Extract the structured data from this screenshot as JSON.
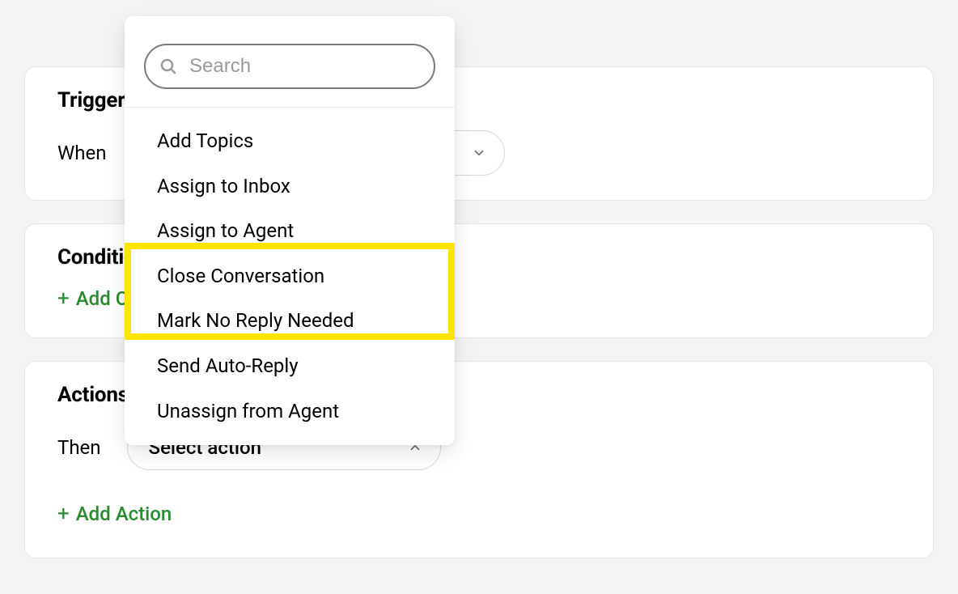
{
  "trigger": {
    "title": "Trigger",
    "when_label": "When"
  },
  "conditions": {
    "title": "Conditions",
    "add_label": "Add Condition"
  },
  "actions": {
    "title": "Actions",
    "then_label": "Then",
    "select_placeholder": "Select action",
    "add_label": "Add Action"
  },
  "popover": {
    "search_placeholder": "Search",
    "options": [
      "Add Topics",
      "Assign to Inbox",
      "Assign to Agent",
      "Close Conversation",
      "Mark No Reply Needed",
      "Send Auto-Reply",
      "Unassign from Agent"
    ]
  }
}
